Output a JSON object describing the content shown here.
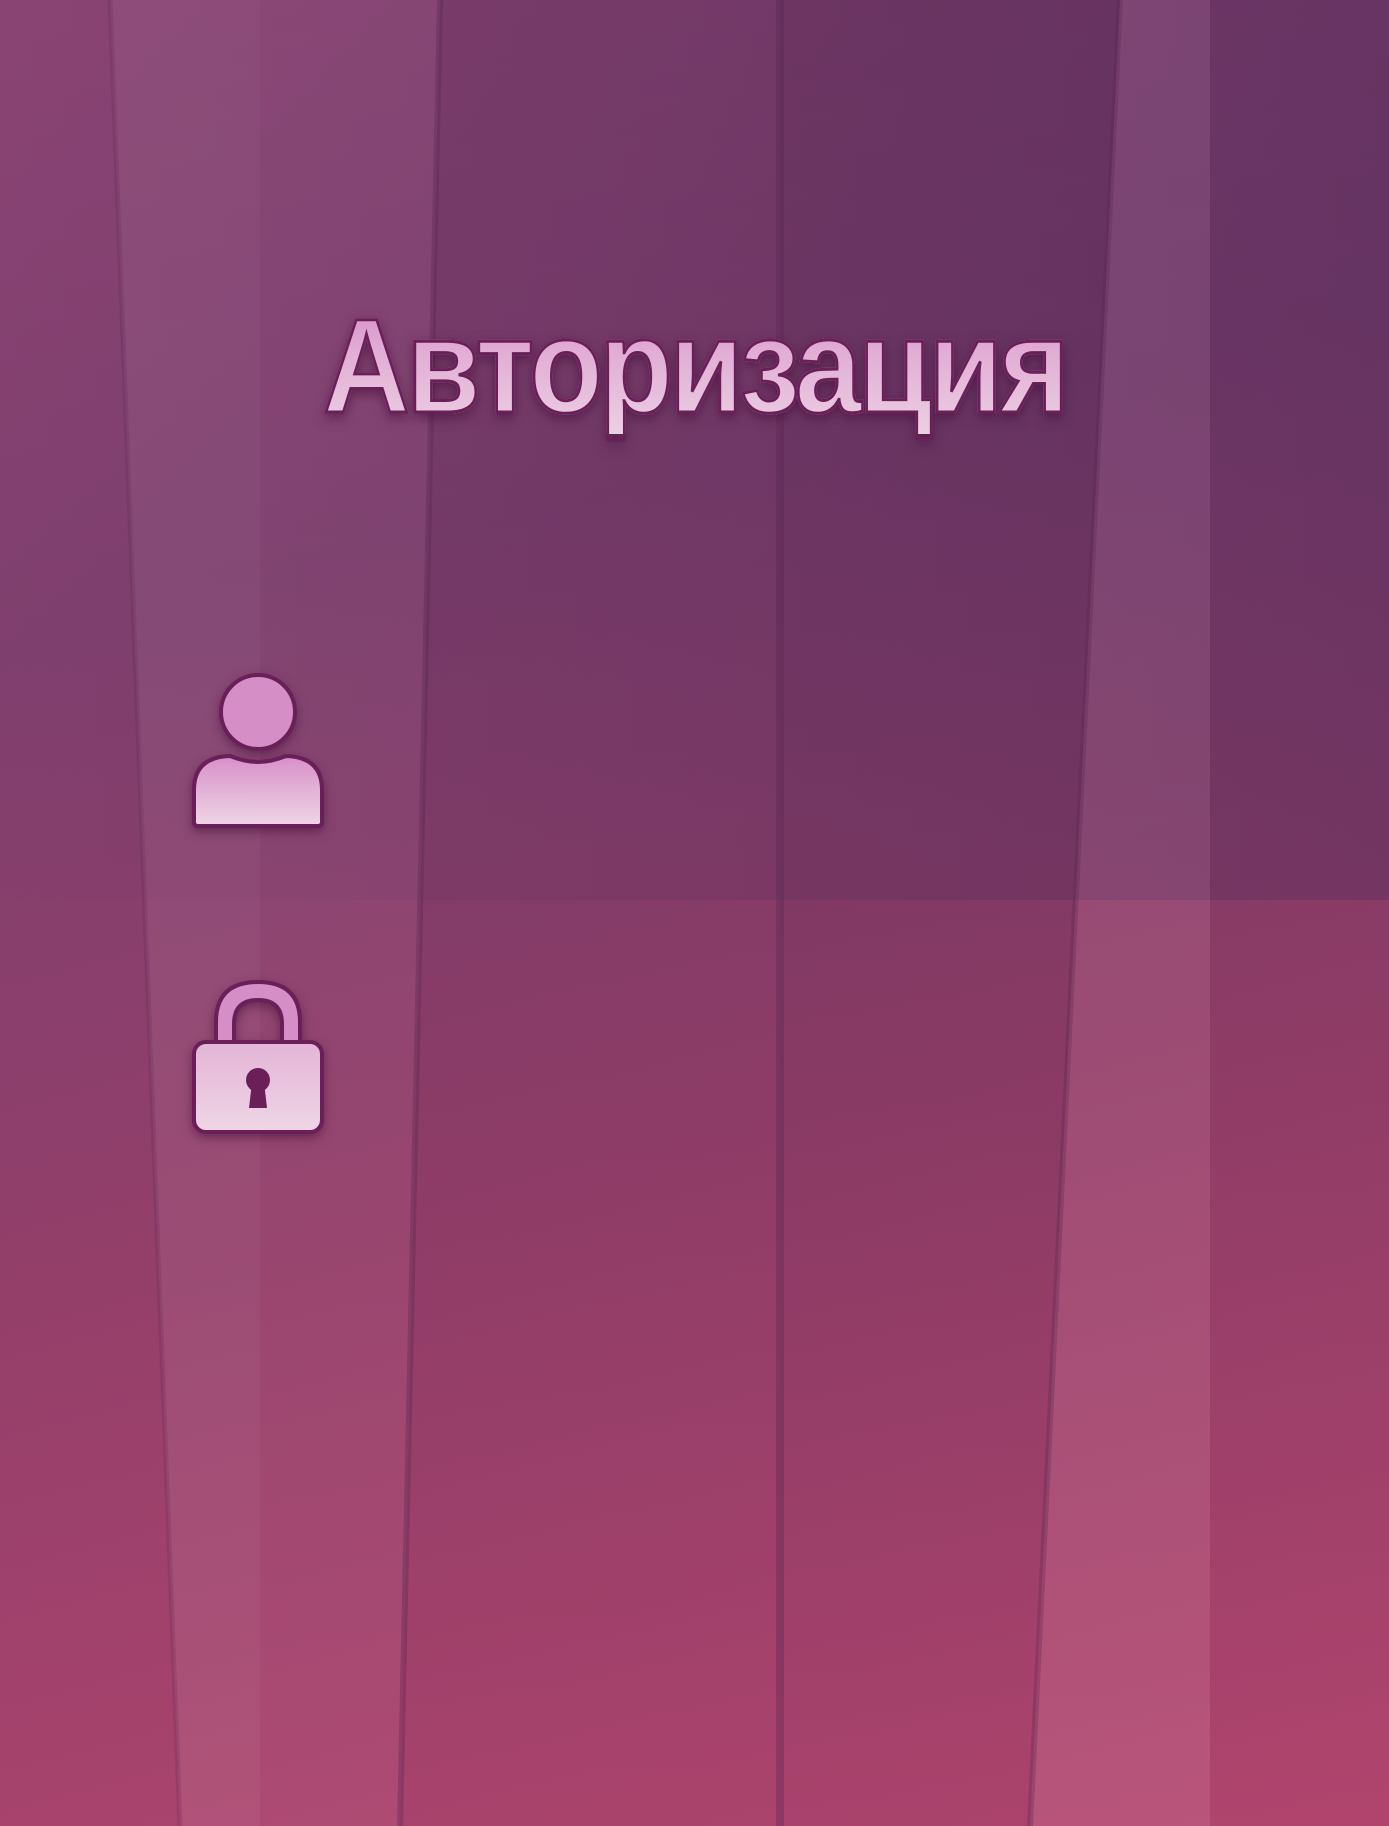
{
  "title": "Авторизация",
  "icons": {
    "user": "user-icon",
    "lock": "lock-icon"
  },
  "colors": {
    "background_top": "#7f3f6e",
    "background_bottom": "#b5466f",
    "title_fill": "#e2aed6",
    "title_outline": "#6a1f58",
    "icon_fill": "#e8c2dd",
    "icon_outline": "#6a1f58"
  }
}
